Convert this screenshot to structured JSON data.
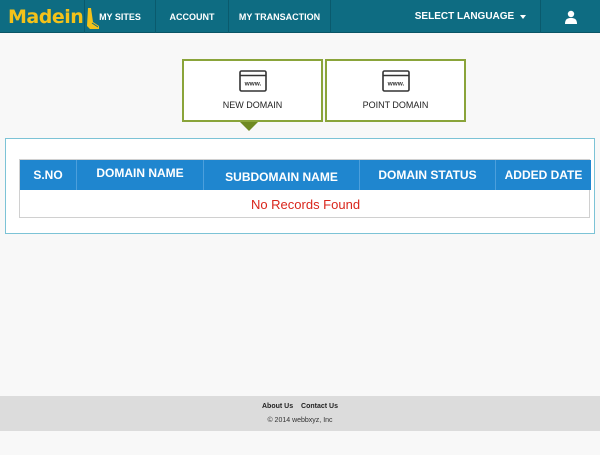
{
  "app": {
    "logo_text": "Madein",
    "brand_color": "#f3c21a",
    "nav_color": "#0e6c82"
  },
  "nav": {
    "my_sites": "MY SITES",
    "account": "ACCOUNT",
    "my_transaction": "MY TRANSACTION",
    "language": "SELECT LANGUAGE",
    "user_icon": "user-icon"
  },
  "tabs": [
    {
      "label": "NEW DOMAIN",
      "icon": "www-browser-icon",
      "active": true
    },
    {
      "label": "POINT DOMAIN",
      "icon": "www-browser-icon",
      "active": false
    }
  ],
  "table": {
    "columns": [
      "S.NO",
      "DOMAIN NAME",
      "SUBDOMAIN NAME",
      "DOMAIN STATUS",
      "ADDED DATE"
    ],
    "rows": [],
    "empty_message": "No Records Found",
    "header_color": "#1f86cf"
  },
  "footer": {
    "links": [
      "About Us",
      "Contact Us"
    ],
    "copyright": "© 2014 webbxyz, Inc"
  }
}
